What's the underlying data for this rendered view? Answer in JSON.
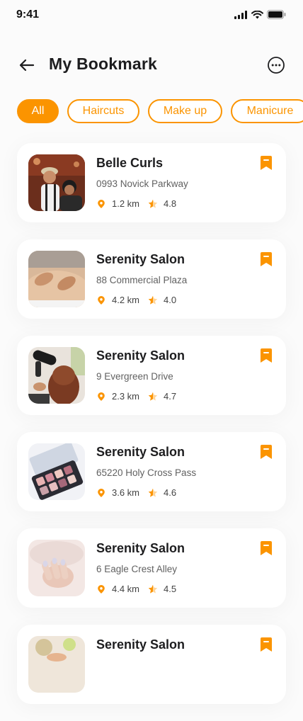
{
  "status": {
    "time": "9:41"
  },
  "header": {
    "title": "My Bookmark"
  },
  "filters": [
    {
      "label": "All",
      "active": true
    },
    {
      "label": "Haircuts",
      "active": false
    },
    {
      "label": "Make up",
      "active": false
    },
    {
      "label": "Manicure",
      "active": false
    }
  ],
  "colors": {
    "accent": "#fb9400",
    "text": "#1d1d1f",
    "subtext": "#616161"
  },
  "bookmarks": [
    {
      "name": "Belle Curls",
      "address": "0993 Novick Parkway",
      "distance": "1.2 km",
      "rating": "4.8",
      "image": "barber-photo"
    },
    {
      "name": "Serenity Salon",
      "address": "88 Commercial Plaza",
      "distance": "4.2 km",
      "rating": "4.0",
      "image": "massage-photo"
    },
    {
      "name": "Serenity Salon",
      "address": "9 Evergreen Drive",
      "distance": "2.3 km",
      "rating": "4.7",
      "image": "hairdryer-photo"
    },
    {
      "name": "Serenity Salon",
      "address": "65220 Holy Cross Pass",
      "distance": "3.6 km",
      "rating": "4.6",
      "image": "eyeshadow-palette-photo"
    },
    {
      "name": "Serenity Salon",
      "address": "6 Eagle Crest Alley",
      "distance": "4.4 km",
      "rating": "4.5",
      "image": "manicure-photo"
    },
    {
      "name": "Serenity Salon",
      "address": "",
      "distance": "",
      "rating": "",
      "image": "spa-photo"
    }
  ]
}
